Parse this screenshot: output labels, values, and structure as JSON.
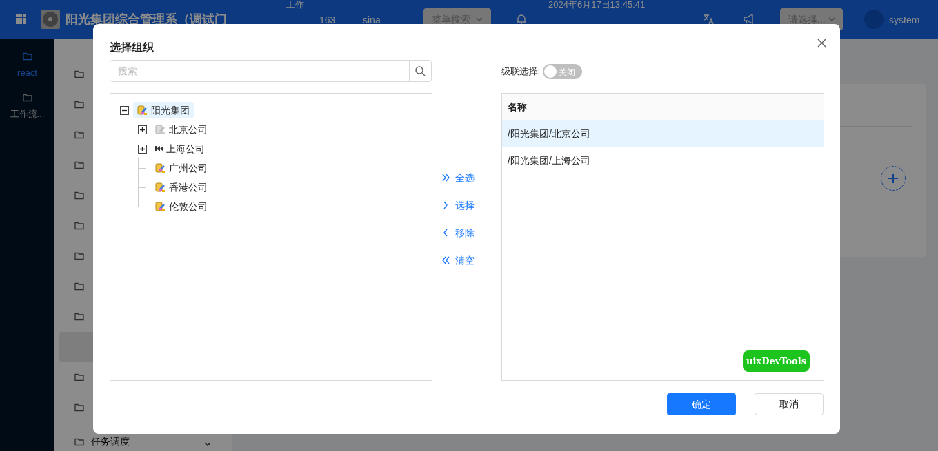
{
  "header": {
    "app_title": "阳光集团综合管理系（调试门",
    "nav_top": "工作",
    "links": [
      "163",
      "sina"
    ],
    "menu_search": {
      "placeholder": "菜单搜索"
    },
    "datetime": "2024年6月17日13:45:41",
    "lang_select": {
      "placeholder": "请选择..."
    },
    "user": "system"
  },
  "app_sidebar": {
    "items": [
      {
        "label": "react",
        "selected": true
      },
      {
        "label": "工作流...",
        "selected": false
      }
    ]
  },
  "menu": {
    "items": [
      {
        "kind": "folder",
        "selected": false
      },
      {
        "kind": "folder",
        "selected": false
      },
      {
        "kind": "folder",
        "selected": false
      },
      {
        "kind": "folder",
        "selected": false
      },
      {
        "kind": "folder",
        "selected": false
      },
      {
        "kind": "folder",
        "selected": false
      },
      {
        "kind": "folder",
        "selected": false
      },
      {
        "kind": "folder",
        "selected": false
      },
      {
        "kind": "folder",
        "selected": false
      },
      {
        "kind": "sub",
        "selected": true
      },
      {
        "kind": "folder",
        "selected": false
      },
      {
        "kind": "folder",
        "selected": false
      },
      {
        "kind": "folder",
        "selected": false,
        "label": "任务调度",
        "expanded": false
      }
    ]
  },
  "dialog": {
    "title": "选择组织",
    "search": {
      "placeholder": "搜索"
    },
    "tree": [
      {
        "label": "阳光集团",
        "kind": "org",
        "expanded": true,
        "selected": true,
        "children": [
          {
            "label": "北京公司",
            "kind": "org_grey",
            "expanded": false,
            "selected": false
          },
          {
            "label": "上海公司",
            "kind": "rewind",
            "expanded": false,
            "selected": false
          },
          {
            "label": "广州公司",
            "kind": "org",
            "selected": false
          },
          {
            "label": "香港公司",
            "kind": "org",
            "selected": false
          },
          {
            "label": "伦敦公司",
            "kind": "org",
            "selected": false
          }
        ]
      }
    ],
    "transfer_buttons": [
      {
        "label": "全选",
        "kind": "all_right"
      },
      {
        "label": "选择",
        "kind": "right"
      },
      {
        "label": "移除",
        "kind": "left"
      },
      {
        "label": "清空",
        "kind": "all_left"
      }
    ],
    "cascade": {
      "label": "级联选择:",
      "on": false,
      "text": "关闭"
    },
    "table": {
      "columns": [
        "名称"
      ],
      "rows": [
        {
          "name": "/阳光集团/北京公司",
          "selected": true
        },
        {
          "name": "/阳光集团/上海公司",
          "selected": false
        }
      ]
    },
    "devtools_button": "uixDevTools",
    "buttons": [
      {
        "label": "确定",
        "kind": "primary"
      },
      {
        "label": "取消",
        "kind": "default"
      }
    ]
  }
}
